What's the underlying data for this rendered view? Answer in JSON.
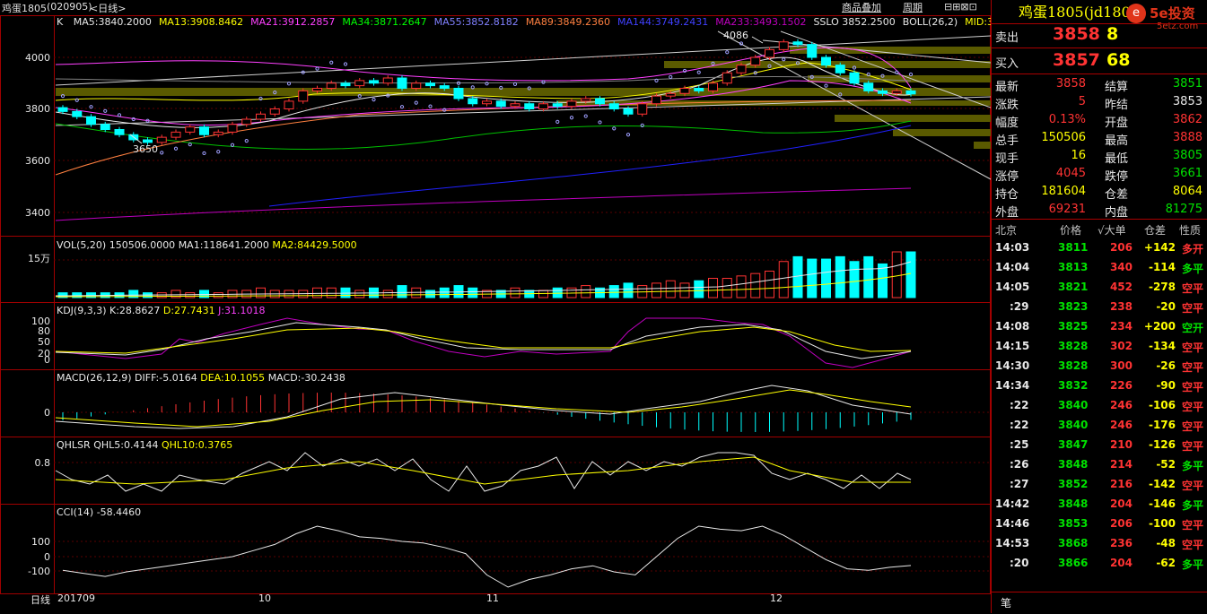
{
  "header": {
    "symbol": "鸡蛋1805",
    "code": "(020905)",
    "period": "<日线>",
    "ma_prefix": "K",
    "ma_items": [
      {
        "text": "MA5:3840.2000",
        "color": "#e8e8e8"
      },
      {
        "text": "MA13:3908.8462",
        "color": "#ffff00"
      },
      {
        "text": "MA21:3912.2857",
        "color": "#ff40ff"
      },
      {
        "text": "MA34:3871.2647",
        "color": "#00ff00"
      },
      {
        "text": "MA55:3852.8182",
        "color": "#8080ff"
      },
      {
        "text": "MA89:3849.2360",
        "color": "#ff8040"
      },
      {
        "text": "MA144:3749.2431",
        "color": "#4040ff"
      },
      {
        "text": "MA233:3493.1502",
        "color": "#c000c0"
      },
      {
        "text": "SSLO 3852.2500",
        "color": "#e8e8e8"
      },
      {
        "text": "BOLL(26,2)",
        "color": "#e8e8e8"
      },
      {
        "text": "MID:3892",
        "color": "#ffff00"
      }
    ],
    "buttons": [
      "商品叠加",
      "周期"
    ]
  },
  "price_axis": [
    "4000",
    "3800",
    "3600",
    "3400"
  ],
  "annotations": {
    "high": "4086",
    "low": "3650"
  },
  "vol": {
    "label": "VOL(5,20)",
    "v": "150506.0000",
    "ma1": "MA1:118641.2000",
    "ma2": "MA2:84429.5000",
    "axis": "15万"
  },
  "kdj": {
    "label": "KDJ(9,3,3)",
    "k": "K:28.8627",
    "d": "D:27.7431",
    "j": "J:31.1018",
    "axis": [
      "100",
      "80",
      "50",
      "20",
      "0"
    ]
  },
  "macd": {
    "label": "MACD(26,12,9)",
    "diff": "DIFF:-5.0164",
    "dea": "DEA:10.1055",
    "macd": "MACD:-30.2438",
    "axis": [
      "0"
    ]
  },
  "qhlsr": {
    "label": "QHLSR",
    "q5": "QHL5:0.4144",
    "q10": "QHL10:0.3765",
    "axis": [
      "0.8"
    ]
  },
  "cci": {
    "label": "CCI(14)",
    "value": "-58.4460",
    "axis": [
      "100",
      "0",
      "-100"
    ]
  },
  "x_axis": {
    "period_label": "日线",
    "dates": [
      "201709",
      "10",
      "11",
      "12"
    ]
  },
  "quote": {
    "title": "鸡蛋1805(jd1805)",
    "logo": "5e投资",
    "logo_sub": "5etz.com",
    "ask_label": "卖出",
    "ask_price": "3858",
    "ask_vol": "8",
    "bid_label": "买入",
    "bid_price": "3857",
    "bid_vol": "68",
    "stats": [
      {
        "l1": "最新",
        "v1": "3858",
        "c1": "red",
        "l2": "结算",
        "v2": "3851",
        "c2": "green"
      },
      {
        "l1": "涨跌",
        "v1": "5",
        "c1": "red",
        "l2": "昨结",
        "v2": "3853",
        "c2": "white"
      },
      {
        "l1": "幅度",
        "v1": "0.13%",
        "c1": "red",
        "l2": "开盘",
        "v2": "3862",
        "c2": "red"
      },
      {
        "l1": "总手",
        "v1": "150506",
        "c1": "yellow",
        "l2": "最高",
        "v2": "3888",
        "c2": "red"
      },
      {
        "l1": "现手",
        "v1": "16",
        "c1": "yellow",
        "l2": "最低",
        "v2": "3805",
        "c2": "green"
      },
      {
        "l1": "涨停",
        "v1": "4045",
        "c1": "red",
        "l2": "跌停",
        "v2": "3661",
        "c2": "green"
      },
      {
        "l1": "持仓",
        "v1": "181604",
        "c1": "yellow",
        "l2": "仓差",
        "v2": "8064",
        "c2": "yellow"
      },
      {
        "l1": "外盘",
        "v1": "69231",
        "c1": "red",
        "l2": "内盘",
        "v2": "81275",
        "c2": "green"
      }
    ],
    "tick_header": [
      "北京",
      "价格",
      "√大单",
      "仓差",
      "性质"
    ],
    "ticks": [
      {
        "time": "14:03",
        "price": "3811",
        "vol": "206",
        "oi": "+142",
        "nature": "多开",
        "nc": "red"
      },
      {
        "time": "14:04",
        "price": "3813",
        "vol": "340",
        "oi": "-114",
        "nature": "多平",
        "nc": "green"
      },
      {
        "time": "14:05",
        "price": "3821",
        "vol": "452",
        "oi": "-278",
        "nature": "空平",
        "nc": "red"
      },
      {
        "time": ":29",
        "price": "3823",
        "vol": "238",
        "oi": "-20",
        "nature": "空平",
        "nc": "red"
      },
      {
        "time": "14:08",
        "price": "3825",
        "vol": "234",
        "oi": "+200",
        "nature": "空开",
        "nc": "green"
      },
      {
        "time": "14:15",
        "price": "3828",
        "vol": "302",
        "oi": "-134",
        "nature": "空平",
        "nc": "red"
      },
      {
        "time": "14:30",
        "price": "3828",
        "vol": "300",
        "oi": "-26",
        "nature": "空平",
        "nc": "red"
      },
      {
        "time": "14:34",
        "price": "3832",
        "vol": "226",
        "oi": "-90",
        "nature": "空平",
        "nc": "red"
      },
      {
        "time": ":22",
        "price": "3840",
        "vol": "246",
        "oi": "-106",
        "nature": "空平",
        "nc": "red"
      },
      {
        "time": ":22",
        "price": "3840",
        "vol": "246",
        "oi": "-176",
        "nature": "空平",
        "nc": "red"
      },
      {
        "time": ":25",
        "price": "3847",
        "vol": "210",
        "oi": "-126",
        "nature": "空平",
        "nc": "red"
      },
      {
        "time": ":26",
        "price": "3848",
        "vol": "214",
        "oi": "-52",
        "nature": "多平",
        "nc": "green"
      },
      {
        "time": ":27",
        "price": "3852",
        "vol": "216",
        "oi": "-142",
        "nature": "空平",
        "nc": "red"
      },
      {
        "time": "14:42",
        "price": "3848",
        "vol": "204",
        "oi": "-146",
        "nature": "多平",
        "nc": "green"
      },
      {
        "time": "14:46",
        "price": "3853",
        "vol": "206",
        "oi": "-100",
        "nature": "空平",
        "nc": "red"
      },
      {
        "time": "14:53",
        "price": "3868",
        "vol": "236",
        "oi": "-48",
        "nature": "空平",
        "nc": "red"
      },
      {
        "time": ":20",
        "price": "3866",
        "vol": "204",
        "oi": "-62",
        "nature": "多平",
        "nc": "green"
      }
    ],
    "footer": "笔"
  },
  "chart_data": {
    "type": "candlestick",
    "closes": [
      3790,
      3770,
      3740,
      3720,
      3700,
      3680,
      3670,
      3690,
      3710,
      3730,
      3700,
      3710,
      3740,
      3760,
      3780,
      3800,
      3830,
      3870,
      3880,
      3900,
      3890,
      3910,
      3900,
      3920,
      3880,
      3900,
      3890,
      3880,
      3840,
      3820,
      3830,
      3810,
      3820,
      3800,
      3820,
      3810,
      3830,
      3840,
      3820,
      3800,
      3780,
      3820,
      3850,
      3860,
      3880,
      3870,
      3900,
      3940,
      3970,
      4000,
      4030,
      4060,
      4050,
      4000,
      3970,
      3940,
      3900,
      3870,
      3860,
      3870,
      3858
    ],
    "volume_index": [
      2,
      2,
      2,
      2,
      2,
      3,
      2,
      2,
      3,
      2,
      3,
      2,
      3,
      3,
      4,
      3,
      3,
      3,
      4,
      4,
      4,
      3,
      4,
      3,
      5,
      4,
      3,
      4,
      5,
      4,
      3,
      3,
      4,
      3,
      3,
      4,
      4,
      5,
      4,
      5,
      6,
      5,
      6,
      7,
      6,
      7,
      8,
      8,
      9,
      10,
      11,
      15,
      17,
      16,
      16,
      17,
      15,
      17,
      14,
      19,
      19
    ],
    "kdj_k": [
      30,
      28,
      26,
      22,
      20,
      25,
      40,
      50,
      55,
      60,
      70,
      80,
      75,
      70,
      65,
      60,
      50,
      40,
      35,
      30,
      28,
      30,
      30,
      28,
      30,
      35,
      40,
      50,
      65,
      75,
      80,
      82,
      85,
      88,
      86,
      70,
      50,
      35,
      25,
      20,
      22,
      25,
      28,
      29
    ],
    "cci": [
      -90,
      -110,
      -130,
      -100,
      -80,
      -60,
      -40,
      -20,
      0,
      40,
      80,
      150,
      200,
      170,
      130,
      120,
      100,
      90,
      60,
      20,
      -120,
      -200,
      -150,
      -120,
      -80,
      -60,
      -100,
      -120,
      0,
      120,
      200,
      180,
      170,
      200,
      140,
      60,
      -20,
      -80,
      -90,
      -70,
      -58
    ]
  }
}
